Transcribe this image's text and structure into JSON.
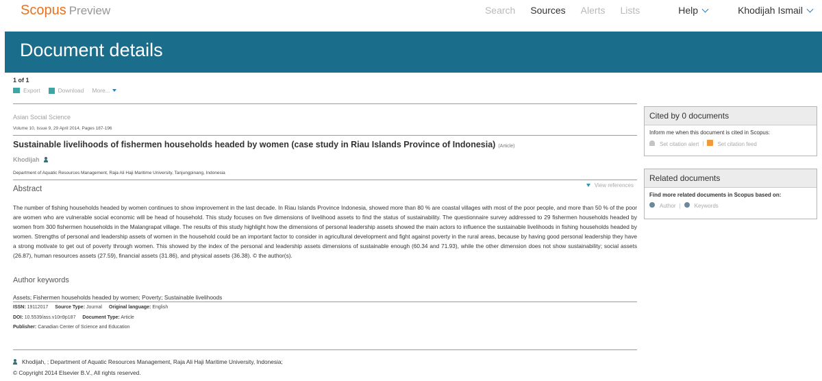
{
  "nav": {
    "logo": "Scopus",
    "logo_suffix": "Preview",
    "links": {
      "search": "Search",
      "sources": "Sources",
      "alerts": "Alerts",
      "lists": "Lists",
      "help": "Help",
      "user": "Khodijah Ismail"
    }
  },
  "banner": {
    "title": "Document details"
  },
  "toolbar": {
    "pager": "1 of 1",
    "export": "Export",
    "download": "Download",
    "more": "More..."
  },
  "doc": {
    "journal": "Asian Social Science",
    "volume": "Volume 10, Issue 9, 29 April 2014, Pages 187-196",
    "title": "Sustainable livelihoods of fishermen households headed by women (case study in Riau Islands Province of Indonesia)",
    "doctype": "(Article)",
    "author": "Khodijah",
    "affiliation": "Department of Aquatic Resources Management, Raja Ali Haji Maritime University, Tanjungpinang, Indonesia",
    "abstract_heading": "Abstract",
    "view_references": "View references",
    "abstract": "The number of fishing households headed by women continues to show improvement in the last decade. In Riau Islands Province Indonesia, showed more than 80 % are coastal villages with most of the poor people, and more than 50 % of the poor are women who are vulnerable social economic will be head of household. This study focuses on five dimensions of livelihood assets to find the status of sustainability. The questionnaire survey addressed to 29 fishermen households headed by women from 300 fishermen households in the Malangrapat village. The results of this study highlight how the dimensions of personal leadership assets showed the main actors to influence the sustainable livelihoods in fishing households headed by women. Strengths of personal and leadership assets of women in the household could be an important factor to consider in agricultural development and fight against poverty in the rural areas, because by having good personal leadership they have a strong motivate to get out of poverty through women. This showed by the index of the personal and leadership assets dimensions of sustainable enough (60.34 and 71.93), while the other dimension does not show sustainability; social assets (26.87), human resources assets (27.59), financial assets (31.86), and physical assets (36.38). © the author(s).",
    "keywords_heading": "Author keywords",
    "keywords": "Assets; Fishermen households headed by women; Poverty; Sustainable livelihoods",
    "meta": {
      "issn_label": "ISSN:",
      "issn": "19112017",
      "source_type_label": "Source Type:",
      "source_type": "Journal",
      "language_label": "Original language:",
      "language": "English",
      "doi_label": "DOI:",
      "doi": "10.5539/ass.v10n9p187",
      "document_type_label": "Document Type:",
      "document_type": "Article",
      "publisher_label": "Publisher:",
      "publisher": "Canadian Center of Science and Education"
    },
    "footer_author": "Khodijah, ; Department of Aquatic Resources Management, Raja Ali Haji Maritime University, Indonesia;",
    "copyright": "© Copyright 2014 Elsevier B.V., All rights reserved."
  },
  "cited_panel": {
    "heading": "Cited by 0 documents",
    "text": "Inform me when this document is cited in Scopus:",
    "alert": "Set citation alert",
    "feed": "Set citation feed"
  },
  "related_panel": {
    "heading": "Related documents",
    "text": "Find more related documents in Scopus based on:",
    "author": "Author",
    "keywords": "Keywords"
  }
}
